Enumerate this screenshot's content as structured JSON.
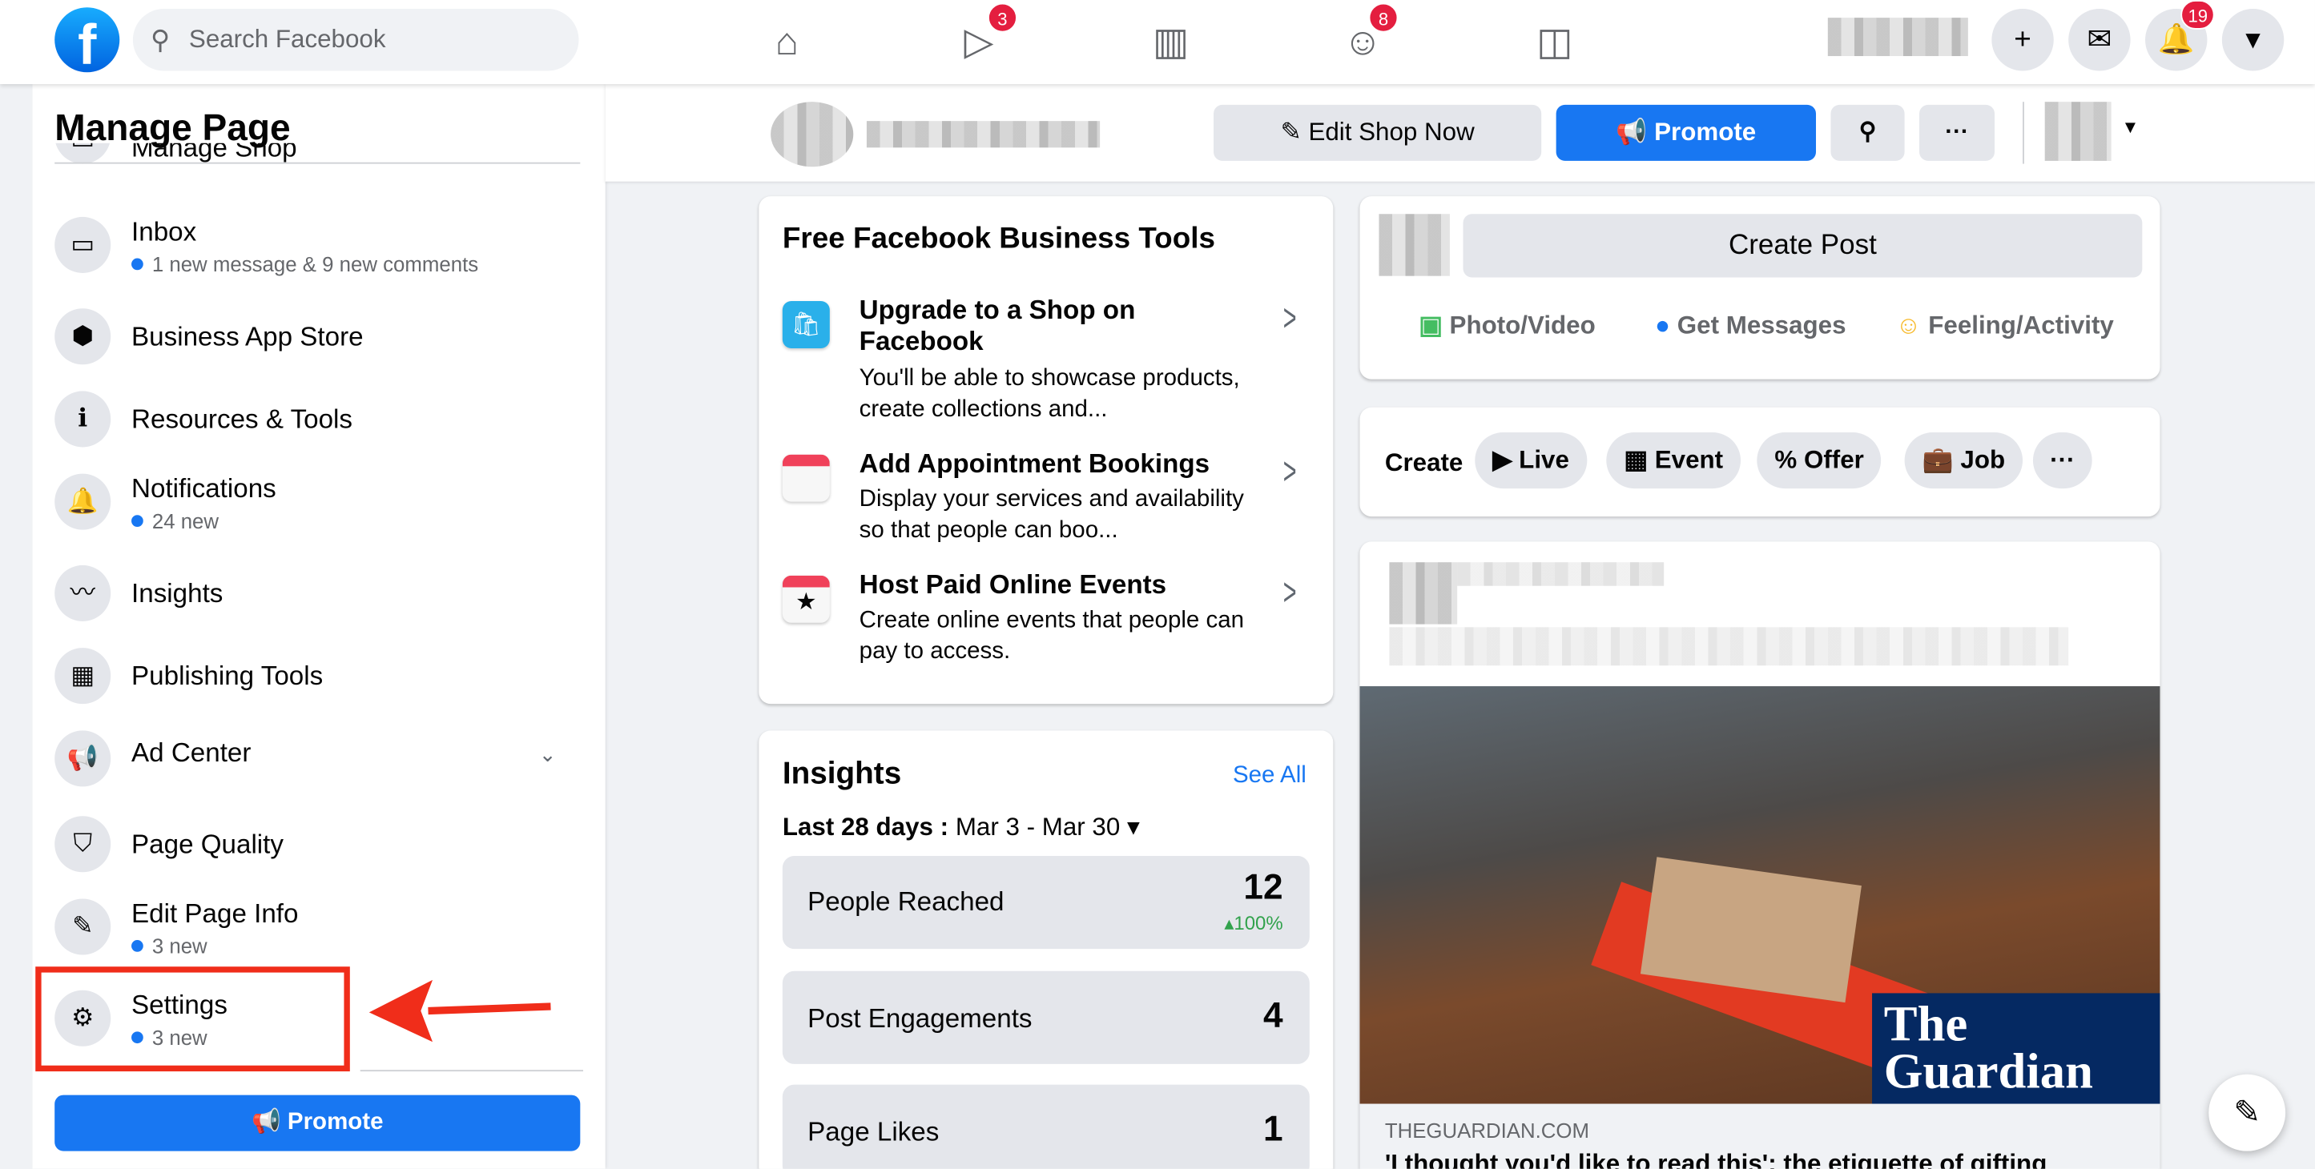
{
  "topbar": {
    "search_placeholder": "Search Facebook",
    "watch_badge": "3",
    "groups_badge": "8",
    "notifications_badge": "19"
  },
  "sidebar": {
    "title": "Manage Page",
    "items": [
      {
        "label": "Manage Shop"
      },
      {
        "label": "Inbox",
        "sub": "1 new message & 9 new comments"
      },
      {
        "label": "Business App Store"
      },
      {
        "label": "Resources & Tools"
      },
      {
        "label": "Notifications",
        "sub": "24 new"
      },
      {
        "label": "Insights"
      },
      {
        "label": "Publishing Tools"
      },
      {
        "label": "Ad Center"
      },
      {
        "label": "Page Quality"
      },
      {
        "label": "Edit Page Info",
        "sub": "3 new"
      },
      {
        "label": "Settings",
        "sub": "3 new"
      }
    ],
    "promote": "Promote"
  },
  "page_header": {
    "edit_shop": "Edit Shop Now",
    "promote": "Promote"
  },
  "tools": {
    "title": "Free Facebook Business Tools",
    "items": [
      {
        "title": "Upgrade to a Shop on Facebook",
        "desc": "You'll be able to showcase products, create collections and..."
      },
      {
        "title": "Add Appointment Bookings",
        "desc": "Display your services and availability so that people can boo..."
      },
      {
        "title": "Host Paid Online Events",
        "desc": "Create online events that people can pay to access."
      }
    ]
  },
  "insights": {
    "title": "Insights",
    "see_all": "See All",
    "range_label": "Last 28 days :",
    "range": "Mar 3 - Mar 30",
    "stats": [
      {
        "label": "People Reached",
        "value": "12",
        "change": "100%"
      },
      {
        "label": "Post Engagements",
        "value": "4"
      },
      {
        "label": "Page Likes",
        "value": "1"
      }
    ]
  },
  "composer": {
    "create_post": "Create Post",
    "photo": "Photo/Video",
    "messages": "Get Messages",
    "feeling": "Feeling/Activity"
  },
  "create_row": {
    "label": "Create",
    "live": "Live",
    "event": "Event",
    "offer": "Offer",
    "job": "Job"
  },
  "post": {
    "logo": "The Guardian",
    "domain": "THEGUARDIAN.COM",
    "headline": "'I thought you'd like to read this': the etiquette of gifting"
  },
  "colors": {
    "brand": "#1877f2",
    "highlight": "#f02d1a",
    "guardian": "#052962"
  }
}
